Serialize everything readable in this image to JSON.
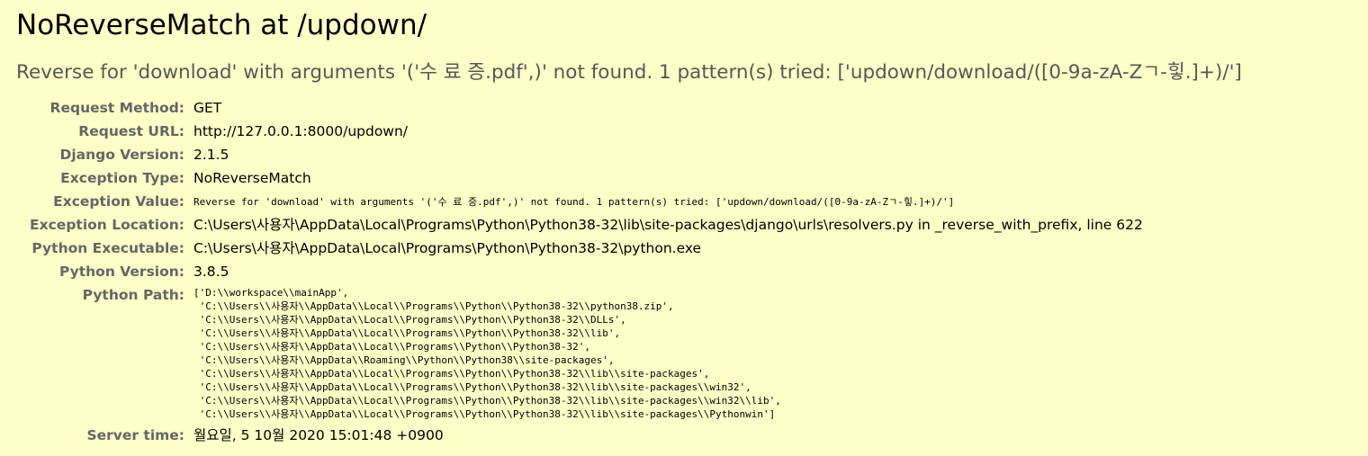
{
  "title": "NoReverseMatch at /updown/",
  "exception_message": "Reverse for 'download' with arguments '('수 료 증.pdf',)' not found. 1 pattern(s) tried: ['updown/download/([0-9a-zA-Zㄱ-힣.]+)/']",
  "meta": {
    "request_method": {
      "label": "Request Method:",
      "value": "GET"
    },
    "request_url": {
      "label": "Request URL:",
      "value": "http://127.0.0.1:8000/updown/"
    },
    "django_version": {
      "label": "Django Version:",
      "value": "2.1.5"
    },
    "exception_type": {
      "label": "Exception Type:",
      "value": "NoReverseMatch"
    },
    "exception_value": {
      "label": "Exception Value:",
      "value": "Reverse for 'download' with arguments '('수 료 증.pdf',)' not found. 1 pattern(s) tried: ['updown/download/([0-9a-zA-Zㄱ-힣.]+)/']"
    },
    "exception_location": {
      "label": "Exception Location:",
      "value": "C:\\Users\\사용자\\AppData\\Local\\Programs\\Python\\Python38-32\\lib\\site-packages\\django\\urls\\resolvers.py in _reverse_with_prefix, line 622"
    },
    "python_executable": {
      "label": "Python Executable:",
      "value": "C:\\Users\\사용자\\AppData\\Local\\Programs\\Python\\Python38-32\\python.exe"
    },
    "python_version": {
      "label": "Python Version:",
      "value": "3.8.5"
    },
    "python_path": {
      "label": "Python Path:",
      "value": "['D:\\\\workspace\\\\mainApp',\n 'C:\\\\Users\\\\사용자\\\\AppData\\\\Local\\\\Programs\\\\Python\\\\Python38-32\\\\python38.zip',\n 'C:\\\\Users\\\\사용자\\\\AppData\\\\Local\\\\Programs\\\\Python\\\\Python38-32\\\\DLLs',\n 'C:\\\\Users\\\\사용자\\\\AppData\\\\Local\\\\Programs\\\\Python\\\\Python38-32\\\\lib',\n 'C:\\\\Users\\\\사용자\\\\AppData\\\\Local\\\\Programs\\\\Python\\\\Python38-32',\n 'C:\\\\Users\\\\사용자\\\\AppData\\\\Roaming\\\\Python\\\\Python38\\\\site-packages',\n 'C:\\\\Users\\\\사용자\\\\AppData\\\\Local\\\\Programs\\\\Python\\\\Python38-32\\\\lib\\\\site-packages',\n 'C:\\\\Users\\\\사용자\\\\AppData\\\\Local\\\\Programs\\\\Python\\\\Python38-32\\\\lib\\\\site-packages\\\\win32',\n 'C:\\\\Users\\\\사용자\\\\AppData\\\\Local\\\\Programs\\\\Python\\\\Python38-32\\\\lib\\\\site-packages\\\\win32\\\\lib',\n 'C:\\\\Users\\\\사용자\\\\AppData\\\\Local\\\\Programs\\\\Python\\\\Python38-32\\\\lib\\\\site-packages\\\\Pythonwin']"
    },
    "server_time": {
      "label": "Server time:",
      "value": "월요일, 5 10월 2020 15:01:48 +0900"
    }
  }
}
